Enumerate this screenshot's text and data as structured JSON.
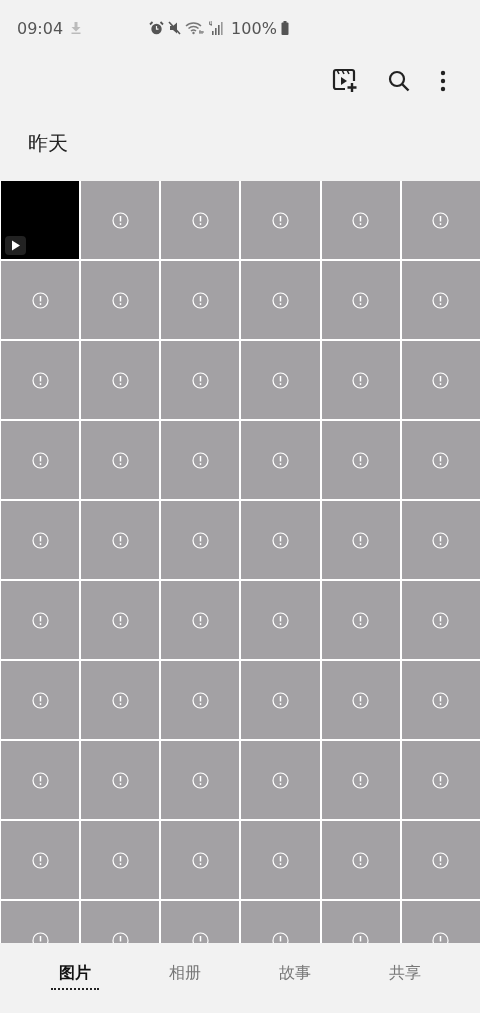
{
  "status_bar": {
    "time": "09:04",
    "battery": "100%"
  },
  "section": {
    "title": "昨天"
  },
  "photos": [
    {
      "kind": "video"
    },
    {
      "kind": "broken"
    },
    {
      "kind": "broken"
    },
    {
      "kind": "broken"
    },
    {
      "kind": "broken"
    },
    {
      "kind": "broken"
    },
    {
      "kind": "broken"
    },
    {
      "kind": "broken"
    },
    {
      "kind": "broken"
    },
    {
      "kind": "broken"
    },
    {
      "kind": "broken"
    },
    {
      "kind": "broken"
    },
    {
      "kind": "broken"
    },
    {
      "kind": "broken"
    },
    {
      "kind": "broken"
    },
    {
      "kind": "broken"
    },
    {
      "kind": "broken"
    },
    {
      "kind": "broken"
    },
    {
      "kind": "broken"
    },
    {
      "kind": "broken"
    },
    {
      "kind": "broken"
    },
    {
      "kind": "broken"
    },
    {
      "kind": "broken"
    },
    {
      "kind": "broken"
    },
    {
      "kind": "broken"
    },
    {
      "kind": "broken"
    },
    {
      "kind": "broken"
    },
    {
      "kind": "broken"
    },
    {
      "kind": "broken"
    },
    {
      "kind": "broken"
    },
    {
      "kind": "broken"
    },
    {
      "kind": "broken"
    },
    {
      "kind": "broken"
    },
    {
      "kind": "broken"
    },
    {
      "kind": "broken"
    },
    {
      "kind": "broken"
    },
    {
      "kind": "broken"
    },
    {
      "kind": "broken"
    },
    {
      "kind": "broken"
    },
    {
      "kind": "broken"
    },
    {
      "kind": "broken"
    },
    {
      "kind": "broken"
    },
    {
      "kind": "broken"
    },
    {
      "kind": "broken"
    },
    {
      "kind": "broken"
    },
    {
      "kind": "broken"
    },
    {
      "kind": "broken"
    },
    {
      "kind": "broken"
    },
    {
      "kind": "broken"
    },
    {
      "kind": "broken"
    },
    {
      "kind": "broken"
    },
    {
      "kind": "broken"
    },
    {
      "kind": "broken"
    },
    {
      "kind": "broken"
    },
    {
      "kind": "broken"
    },
    {
      "kind": "broken"
    },
    {
      "kind": "broken"
    },
    {
      "kind": "broken"
    },
    {
      "kind": "broken"
    },
    {
      "kind": "broken"
    }
  ],
  "tabs": [
    {
      "label": "图片",
      "selected": true
    },
    {
      "label": "相册",
      "selected": false
    },
    {
      "label": "故事",
      "selected": false
    },
    {
      "label": "共享",
      "selected": false
    }
  ]
}
